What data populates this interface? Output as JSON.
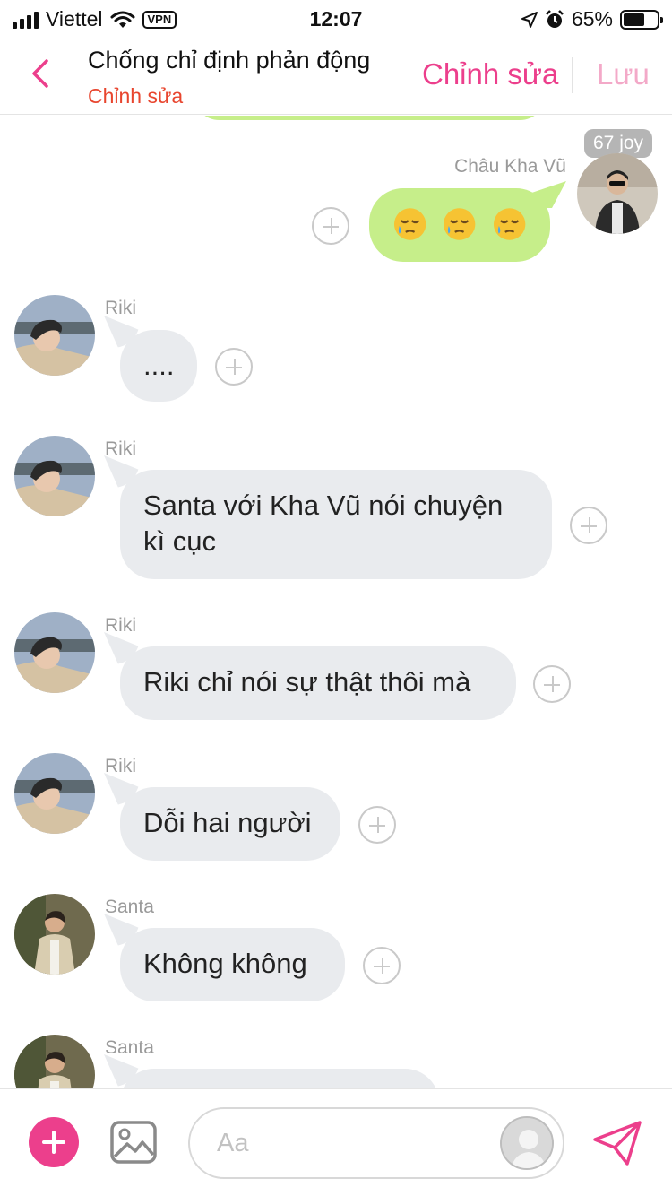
{
  "status_bar": {
    "carrier": "Viettel",
    "vpn": "VPN",
    "time": "12:07",
    "battery_percent": "65%",
    "battery_level": 0.65
  },
  "header": {
    "title": "Chống chỉ định phản động",
    "subtitle": "Chỉnh sửa",
    "edit_label": "Chỉnh sửa",
    "save_label": "Lưu"
  },
  "messages": [
    {
      "sender": "Châu Kha Vũ",
      "direction": "outgoing",
      "badge": "67 joy",
      "emoji": [
        "sleepy-face",
        "sleepy-face",
        "sleepy-face"
      ]
    },
    {
      "sender": "Riki",
      "direction": "incoming",
      "text": "...."
    },
    {
      "sender": "Riki",
      "direction": "incoming",
      "text_line1": "Santa với Kha Vũ nói chuyện",
      "text_line2": "kì cục"
    },
    {
      "sender": "Riki",
      "direction": "incoming",
      "text": "Riki chỉ nói sự thật thôi mà"
    },
    {
      "sender": "Riki",
      "direction": "incoming",
      "text": "Dỗi hai người"
    },
    {
      "sender": "Santa",
      "direction": "incoming",
      "text": "Không không"
    },
    {
      "sender": "Santa",
      "direction": "incoming",
      "text": ""
    }
  ],
  "composer": {
    "placeholder": "Aa"
  },
  "colors": {
    "accent": "#ec3f8c",
    "subtitle": "#e8452e",
    "outgoing_bubble": "#c6ee8a",
    "incoming_bubble": "#e9ebee"
  }
}
